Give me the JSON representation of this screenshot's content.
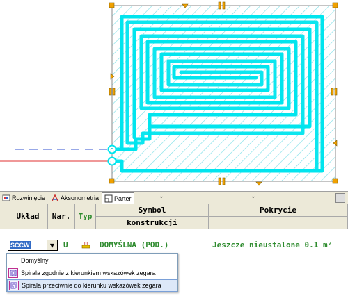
{
  "colors": {
    "pipe": "#00e5ee",
    "hatch": "#7fe0e8",
    "handle": "#f0a000",
    "dash": "#3050d0",
    "redline": "#e03030"
  },
  "tabs": [
    {
      "label": "Rozwinięcie",
      "icon": "unfold-icon",
      "active": false
    },
    {
      "label": "Aksonometria",
      "icon": "axonometry-icon",
      "active": false
    },
    {
      "label": "Parter",
      "icon": "floor-plan-icon",
      "active": true
    }
  ],
  "table": {
    "headers": {
      "uklad": "Układ",
      "nar": "Nar.",
      "typ": "Typ",
      "symbol": "Symbol",
      "konstrukcji": "konstrukcji",
      "pokrycie": "Pokrycie"
    },
    "row": {
      "uklad_value": "SCCW",
      "nar": "U",
      "typ_icon": "radiator-icon",
      "symbol": "DOMYŚLNA (POD.)",
      "pokrycie": "Jeszcze nieustalone 0.1 m²"
    }
  },
  "dropdown": {
    "options": [
      {
        "label": "Domyślny",
        "icon": ""
      },
      {
        "label": "Spirala zgodnie z kierunkiem wskazówek zegara",
        "icon": "spiral-cw-icon"
      },
      {
        "label": "Spirala przeciwnie do kierunku wskazówek zegara",
        "icon": "spiral-ccw-icon",
        "selected": true
      }
    ]
  }
}
